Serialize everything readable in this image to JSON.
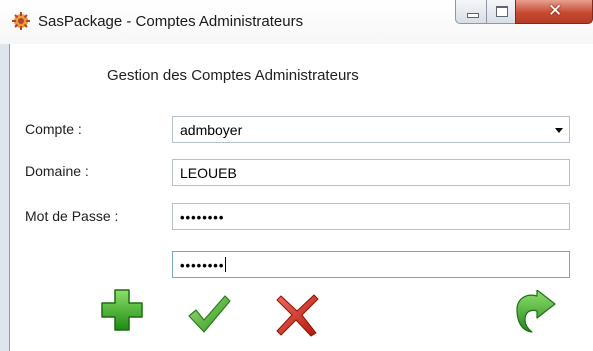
{
  "window": {
    "title": "SasPackage - Comptes Administrateurs",
    "app_icon": "saspackage-icon",
    "controls": [
      "minimize-icon",
      "maximize-icon",
      "close-icon"
    ]
  },
  "form": {
    "heading": "Gestion des Comptes Administrateurs",
    "account_label": "Compte :",
    "account_value": "admboyer",
    "domain_label": "Domaine :",
    "domain_value": "LEOUEB",
    "password_label": "Mot de Passe :",
    "password_mask": "••••••••",
    "password_confirm_mask": "••••••••"
  },
  "actions": {
    "icons": [
      "add-icon",
      "validate-check-icon",
      "cancel-x-icon",
      "back-arrow-icon"
    ],
    "colors": {
      "add": "#2e9b1f",
      "validate": "#3aa02a",
      "cancel": "#d32a1e",
      "back": "#2f9a27"
    }
  }
}
